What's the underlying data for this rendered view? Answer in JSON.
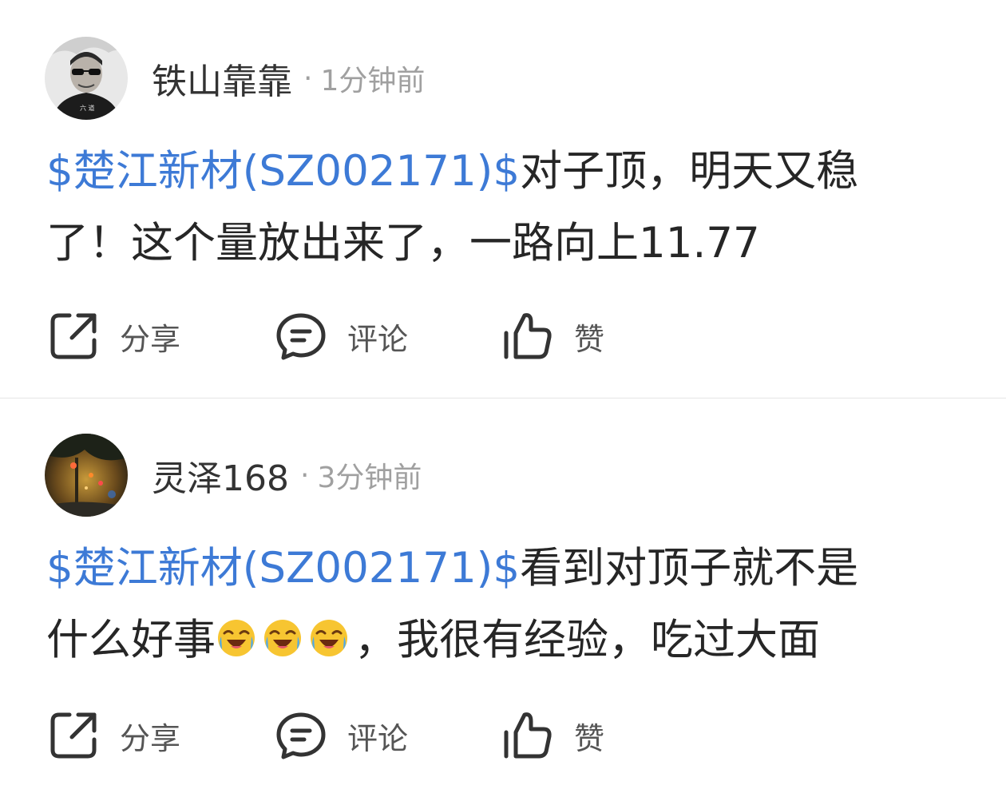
{
  "posts": [
    {
      "username": "铁山靠靠",
      "separator": "·",
      "time": "1分钟前",
      "stock_tag": "$楚江新材(SZ002171)$",
      "text_line1_rest": "对子顶，明天又稳",
      "text_line2": "了！这个量放出来了，一路向上11.77",
      "actions": {
        "share": "分享",
        "comment": "评论",
        "like": "赞"
      },
      "avatar_icon": "avatar-man-sunglasses"
    },
    {
      "username": "灵泽168",
      "separator": "·",
      "time": "3分钟前",
      "stock_tag": "$楚江新材(SZ002171)$",
      "text_line1_rest": "看到对顶子就不是",
      "text_line2_before_emoji": "什么好事",
      "emoji_icons": [
        "rofl-emoji",
        "rofl-emoji",
        "rofl-emoji"
      ],
      "text_line2_after_emoji": "，我很有经验，吃过大面",
      "actions": {
        "share": "分享",
        "comment": "评论",
        "like": "赞"
      },
      "avatar_icon": "avatar-night-street"
    }
  ],
  "colors": {
    "stock_link": "#3d7ad6",
    "text": "#262626",
    "meta": "#a0a0a0",
    "icon": "#333333"
  }
}
